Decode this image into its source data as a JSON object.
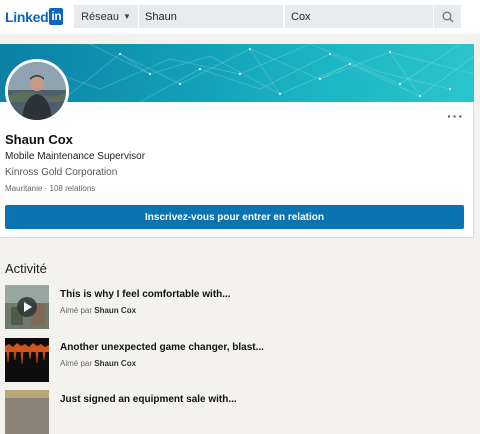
{
  "header": {
    "logo_text": "Linked",
    "logo_in": "in",
    "network_label": "Réseau",
    "search_first_value": "Shaun",
    "search_last_value": "Cox"
  },
  "profile": {
    "name": "Shaun Cox",
    "headline": "Mobile Maintenance Supervisor",
    "company": "Kinross Gold Corporation",
    "location": "Mauritanie",
    "separator": "·",
    "connections": "108 relations",
    "more_label": "···",
    "connect_button": "Inscrivez-vous pour entrer en relation"
  },
  "activity": {
    "title": "Activité",
    "liked_prefix": "Aimé par",
    "items": [
      {
        "title": "This is why I feel comfortable with...",
        "liked_by": "Shaun Cox",
        "thumb": "video"
      },
      {
        "title": "Another unexpected game changer, blast...",
        "liked_by": "Shaun Cox",
        "thumb": "blast"
      },
      {
        "title": "Just signed an equipment sale with...",
        "liked_by": "Shaun Cox",
        "thumb": "equipment"
      }
    ]
  },
  "colors": {
    "brand": "#0a66c2",
    "connect_button": "#0a73b1",
    "banner": "#12a0b8"
  }
}
